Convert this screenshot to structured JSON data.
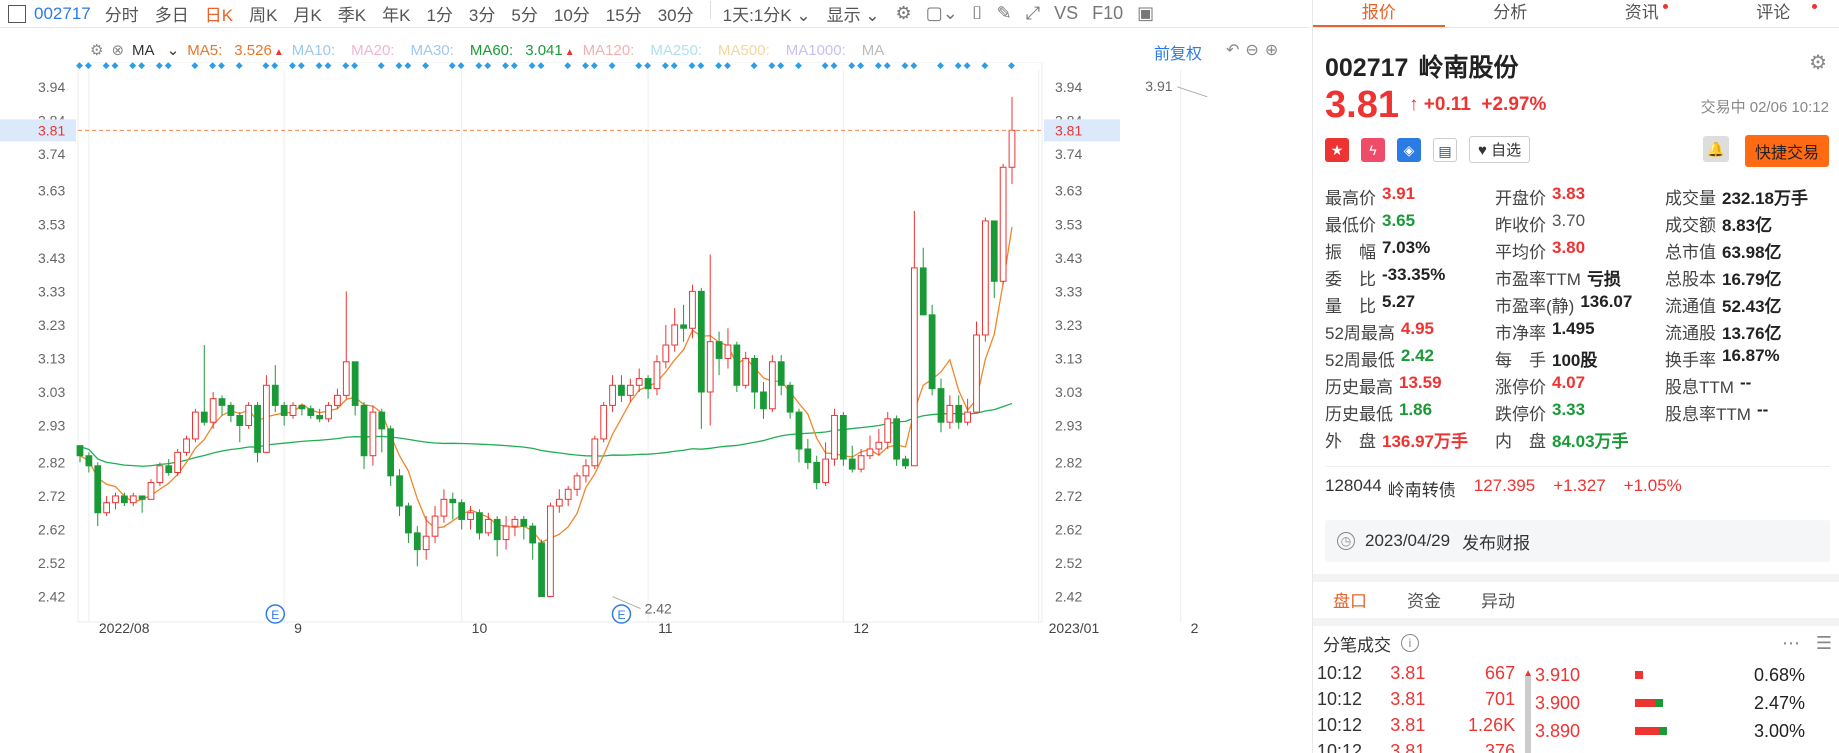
{
  "toolbar": {
    "code": "002717",
    "periods": [
      "分时",
      "多日",
      "日K",
      "周K",
      "月K",
      "季K",
      "年K",
      "1分",
      "3分",
      "5分",
      "10分",
      "15分",
      "30分"
    ],
    "active": "日K",
    "interval": "1天:1分K",
    "display": "显示",
    "vs": "VS",
    "f10": "F10"
  },
  "ma": {
    "type": "MA",
    "items": [
      {
        "label": "MA5:",
        "value": "3.526",
        "color": "#e8762a"
      },
      {
        "label": "MA10:",
        "value": "",
        "color": "#9ec8f0"
      },
      {
        "label": "MA20:",
        "value": "",
        "color": "#f0b6d0"
      },
      {
        "label": "MA30:",
        "value": "",
        "color": "#9ec8f0"
      },
      {
        "label": "MA60:",
        "value": "3.041",
        "color": "#1a9a37"
      },
      {
        "label": "MA120:",
        "value": "",
        "color": "#f3b0b0"
      },
      {
        "label": "MA250:",
        "value": "",
        "color": "#b0e0f0"
      },
      {
        "label": "MA500:",
        "value": "",
        "color": "#f3d6a0"
      },
      {
        "label": "MA1000:",
        "value": "",
        "color": "#c8c0f0"
      },
      {
        "label": "MA",
        "value": "",
        "color": "#bbbbbb"
      }
    ],
    "adjust": "前复权"
  },
  "chart_data": {
    "type": "candlestick",
    "y_ticks": [
      "3.94",
      "3.84",
      "3.74",
      "3.63",
      "3.53",
      "3.43",
      "3.33",
      "3.23",
      "3.13",
      "3.03",
      "2.93",
      "2.82",
      "2.72",
      "2.62",
      "2.52",
      "2.42"
    ],
    "x_ticks": [
      {
        "label": "2022/08",
        "i": 1
      },
      {
        "label": "9",
        "i": 23
      },
      {
        "label": "10",
        "i": 43
      },
      {
        "label": "11",
        "i": 64
      },
      {
        "label": "12",
        "i": 86
      },
      {
        "label": "2023/01",
        "i": 108
      },
      {
        "label": "2",
        "i": 124
      }
    ],
    "ylim": [
      2.38,
      3.99
    ],
    "current_price": "3.81",
    "annotations": [
      {
        "text": "3.91",
        "i": 127,
        "value": 3.91
      },
      {
        "text": "2.42",
        "i": 60,
        "value": 2.42
      }
    ],
    "event_markers": [
      {
        "text": "E",
        "i": 22
      },
      {
        "text": "E",
        "i": 61
      }
    ],
    "candles": [
      [
        2.87,
        2.84,
        2.87,
        2.82
      ],
      [
        2.84,
        2.81,
        2.85,
        2.79
      ],
      [
        2.81,
        2.67,
        2.82,
        2.63
      ],
      [
        2.67,
        2.7,
        2.72,
        2.66
      ],
      [
        2.7,
        2.72,
        2.73,
        2.68
      ],
      [
        2.72,
        2.7,
        2.73,
        2.69
      ],
      [
        2.7,
        2.72,
        2.73,
        2.69
      ],
      [
        2.72,
        2.71,
        2.72,
        2.67
      ],
      [
        2.71,
        2.76,
        2.77,
        2.71
      ],
      [
        2.76,
        2.81,
        2.82,
        2.75
      ],
      [
        2.81,
        2.79,
        2.83,
        2.78
      ],
      [
        2.79,
        2.85,
        2.86,
        2.78
      ],
      [
        2.85,
        2.89,
        2.9,
        2.84
      ],
      [
        2.89,
        2.97,
        2.98,
        2.88
      ],
      [
        2.97,
        2.94,
        3.17,
        2.93
      ],
      [
        2.94,
        3.01,
        3.03,
        2.92
      ],
      [
        3.01,
        2.99,
        3.02,
        2.96
      ],
      [
        2.99,
        2.96,
        3.0,
        2.94
      ],
      [
        2.96,
        2.93,
        2.97,
        2.88
      ],
      [
        2.93,
        2.99,
        3.0,
        2.92
      ],
      [
        2.99,
        2.85,
        3.0,
        2.82
      ],
      [
        2.85,
        3.05,
        3.08,
        2.85
      ],
      [
        3.05,
        2.99,
        3.11,
        2.97
      ],
      [
        2.99,
        2.96,
        3.0,
        2.93
      ],
      [
        2.96,
        2.99,
        3.0,
        2.95
      ],
      [
        2.99,
        2.98,
        2.99,
        2.96
      ],
      [
        2.98,
        2.96,
        2.99,
        2.95
      ],
      [
        2.96,
        2.95,
        2.98,
        2.94
      ],
      [
        2.95,
        2.99,
        3.0,
        2.94
      ],
      [
        2.99,
        3.02,
        3.04,
        2.98
      ],
      [
        3.02,
        3.12,
        3.33,
        3.01
      ],
      [
        3.12,
        2.99,
        3.12,
        2.96
      ],
      [
        2.99,
        2.84,
        3.0,
        2.8
      ],
      [
        2.84,
        2.97,
        2.99,
        2.81
      ],
      [
        2.97,
        2.92,
        2.98,
        2.85
      ],
      [
        2.92,
        2.78,
        2.93,
        2.75
      ],
      [
        2.78,
        2.69,
        2.8,
        2.66
      ],
      [
        2.69,
        2.61,
        2.7,
        2.58
      ],
      [
        2.61,
        2.56,
        2.63,
        2.51
      ],
      [
        2.56,
        2.6,
        2.66,
        2.53
      ],
      [
        2.6,
        2.66,
        2.69,
        2.58
      ],
      [
        2.66,
        2.71,
        2.74,
        2.64
      ],
      [
        2.71,
        2.7,
        2.73,
        2.65
      ],
      [
        2.7,
        2.65,
        2.71,
        2.62
      ],
      [
        2.65,
        2.67,
        2.69,
        2.62
      ],
      [
        2.67,
        2.61,
        2.68,
        2.59
      ],
      [
        2.61,
        2.65,
        2.67,
        2.6
      ],
      [
        2.65,
        2.59,
        2.66,
        2.54
      ],
      [
        2.59,
        2.63,
        2.66,
        2.56
      ],
      [
        2.63,
        2.65,
        2.66,
        2.6
      ],
      [
        2.65,
        2.63,
        2.66,
        2.59
      ],
      [
        2.63,
        2.58,
        2.64,
        2.53
      ],
      [
        2.58,
        2.42,
        2.59,
        2.42
      ],
      [
        2.42,
        2.69,
        2.7,
        2.42
      ],
      [
        2.69,
        2.71,
        2.74,
        2.67
      ],
      [
        2.71,
        2.74,
        2.75,
        2.69
      ],
      [
        2.74,
        2.78,
        2.79,
        2.72
      ],
      [
        2.78,
        2.81,
        2.83,
        2.76
      ],
      [
        2.81,
        2.89,
        2.9,
        2.8
      ],
      [
        2.89,
        2.99,
        3.0,
        2.88
      ],
      [
        2.99,
        3.05,
        3.08,
        2.97
      ],
      [
        3.05,
        3.02,
        3.08,
        3.0
      ],
      [
        3.02,
        3.05,
        3.07,
        3.0
      ],
      [
        3.05,
        3.07,
        3.1,
        3.03
      ],
      [
        3.07,
        3.04,
        3.08,
        3.01
      ],
      [
        3.04,
        3.12,
        3.14,
        3.02
      ],
      [
        3.12,
        3.17,
        3.23,
        3.1
      ],
      [
        3.17,
        3.23,
        3.28,
        3.15
      ],
      [
        3.23,
        3.22,
        3.29,
        3.18
      ],
      [
        3.22,
        3.33,
        3.35,
        3.19
      ],
      [
        3.33,
        3.03,
        3.34,
        2.92
      ],
      [
        3.03,
        3.18,
        3.44,
        2.93
      ],
      [
        3.18,
        3.13,
        3.21,
        3.08
      ],
      [
        3.13,
        3.17,
        3.22,
        3.1
      ],
      [
        3.17,
        3.05,
        3.18,
        3.03
      ],
      [
        3.05,
        3.13,
        3.15,
        3.04
      ],
      [
        3.13,
        3.03,
        3.14,
        2.98
      ],
      [
        3.03,
        2.98,
        3.06,
        2.95
      ],
      [
        2.98,
        3.12,
        3.14,
        2.97
      ],
      [
        3.12,
        3.05,
        3.14,
        3.02
      ],
      [
        3.05,
        2.97,
        3.06,
        2.95
      ],
      [
        2.97,
        2.86,
        2.98,
        2.82
      ],
      [
        2.86,
        2.82,
        2.89,
        2.8
      ],
      [
        2.82,
        2.76,
        2.84,
        2.74
      ],
      [
        2.76,
        2.83,
        2.88,
        2.75
      ],
      [
        2.83,
        2.96,
        2.98,
        2.81
      ],
      [
        2.96,
        2.83,
        2.97,
        2.81
      ],
      [
        2.83,
        2.8,
        2.87,
        2.79
      ],
      [
        2.8,
        2.84,
        2.86,
        2.79
      ],
      [
        2.84,
        2.86,
        2.9,
        2.83
      ],
      [
        2.86,
        2.88,
        2.92,
        2.84
      ],
      [
        2.88,
        2.95,
        2.97,
        2.86
      ],
      [
        2.95,
        2.83,
        2.96,
        2.81
      ],
      [
        2.83,
        2.81,
        2.84,
        2.8
      ],
      [
        2.81,
        3.4,
        3.57,
        2.9
      ],
      [
        3.4,
        3.26,
        3.46,
        3.26
      ],
      [
        3.26,
        3.04,
        3.29,
        3.02
      ],
      [
        3.04,
        2.94,
        3.07,
        2.91
      ],
      [
        2.94,
        2.99,
        3.02,
        2.92
      ],
      [
        2.99,
        2.94,
        3.02,
        2.92
      ],
      [
        2.94,
        2.97,
        3.01,
        2.93
      ],
      [
        2.97,
        3.2,
        3.24,
        2.97
      ],
      [
        3.2,
        3.54,
        3.55,
        3.18
      ],
      [
        3.54,
        3.36,
        3.54,
        3.31
      ],
      [
        3.36,
        3.7,
        3.71,
        3.35
      ],
      [
        3.7,
        3.81,
        3.91,
        3.65
      ]
    ]
  },
  "quote_tabs": [
    "报价",
    "分析",
    "资讯",
    "评论"
  ],
  "stock": {
    "code": "002717",
    "name": "岭南股份",
    "price": "3.81",
    "arrow": "↑",
    "change": "+0.11",
    "pct": "+2.97%",
    "status": "交易中 02/06 10:12",
    "watch": "自选",
    "trade": "快捷交易"
  },
  "stats": [
    [
      {
        "l": "最高价",
        "v": "3.91",
        "c": "red"
      },
      {
        "l": "开盘价",
        "v": "3.83",
        "c": "red"
      },
      {
        "l": "成交量",
        "v": "232.18万手",
        "c": "blk"
      }
    ],
    [
      {
        "l": "最低价",
        "v": "3.65",
        "c": "green"
      },
      {
        "l": "昨收价",
        "v": "3.70",
        "c": "gray"
      },
      {
        "l": "成交额",
        "v": "8.83亿",
        "c": "blk"
      }
    ],
    [
      {
        "l": "振　幅",
        "v": "7.03%",
        "c": "blk"
      },
      {
        "l": "平均价",
        "v": "3.80",
        "c": "red"
      },
      {
        "l": "总市值",
        "v": "63.98亿",
        "c": "blk"
      }
    ],
    [
      {
        "l": "委　比",
        "v": "-33.35%",
        "c": "blk"
      },
      {
        "l": "市盈率TTM",
        "v": "亏损",
        "c": "blk"
      },
      {
        "l": "总股本",
        "v": "16.79亿",
        "c": "blk"
      }
    ],
    [
      {
        "l": "量　比",
        "v": "5.27",
        "c": "blk"
      },
      {
        "l": "市盈率(静)",
        "v": "136.07",
        "c": "blk"
      },
      {
        "l": "流通值",
        "v": "52.43亿",
        "c": "blk"
      }
    ],
    [
      {
        "l": "52周最高",
        "v": "4.95",
        "c": "red"
      },
      {
        "l": "市净率",
        "v": "1.495",
        "c": "blk"
      },
      {
        "l": "流通股",
        "v": "13.76亿",
        "c": "blk"
      }
    ],
    [
      {
        "l": "52周最低",
        "v": "2.42",
        "c": "green"
      },
      {
        "l": "每　手",
        "v": "100股",
        "c": "blk"
      },
      {
        "l": "换手率",
        "v": "16.87%",
        "c": "blk"
      }
    ],
    [
      {
        "l": "历史最高",
        "v": "13.59",
        "c": "red"
      },
      {
        "l": "涨停价",
        "v": "4.07",
        "c": "red"
      },
      {
        "l": "股息TTM",
        "v": "--",
        "c": "blk"
      }
    ],
    [
      {
        "l": "历史最低",
        "v": "1.86",
        "c": "green"
      },
      {
        "l": "跌停价",
        "v": "3.33",
        "c": "green"
      },
      {
        "l": "股息率TTM",
        "v": "--",
        "c": "blk"
      }
    ],
    [
      {
        "l": "外　盘",
        "v": "136.97万手",
        "c": "red"
      },
      {
        "l": "内　盘",
        "v": "84.03万手",
        "c": "green"
      }
    ]
  ],
  "bond": {
    "code": "128044",
    "name": "岭南转债",
    "price": "127.395",
    "change": "+1.327",
    "pct": "+1.05%"
  },
  "report": {
    "date": "2023/04/29",
    "text": "发布财报"
  },
  "sub_tabs": [
    "盘口",
    "资金",
    "异动"
  ],
  "ticks_title": "分笔成交",
  "ticks": [
    {
      "t": "10:12",
      "p": "3.81",
      "v": "667"
    },
    {
      "t": "10:12",
      "p": "3.81",
      "v": "701"
    },
    {
      "t": "10:12",
      "p": "3.81",
      "v": "1.26K"
    },
    {
      "t": "10:12",
      "p": "3.81",
      "v": "376"
    }
  ],
  "dist": [
    {
      "p": "3.910",
      "pct": "0.68%",
      "r": 0.04,
      "g": 0
    },
    {
      "p": "3.900",
      "pct": "2.47%",
      "r": 0.1,
      "g": 0.04
    },
    {
      "p": "3.890",
      "pct": "3.00%",
      "r": 0.12,
      "g": 0.04
    }
  ]
}
